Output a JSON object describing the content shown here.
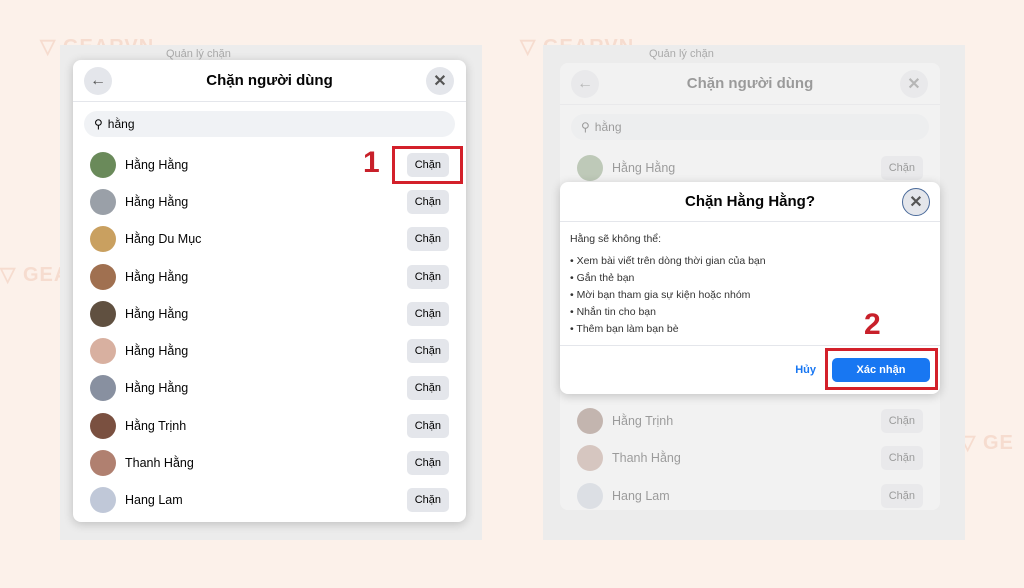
{
  "watermark": "GEARVN",
  "left": {
    "bg_heading": "Quản lý chặn",
    "title": "Chặn người dùng",
    "search_value": "hằng",
    "step": "1",
    "block_label": "Chặn",
    "users": [
      {
        "name": "Hằng Hằng",
        "color": "#6a8a5a"
      },
      {
        "name": "Hằng Hằng",
        "color": "#9aa0a8"
      },
      {
        "name": "Hằng Du Mục",
        "color": "#c9a060"
      },
      {
        "name": "Hằng Hằng",
        "color": "#a07050"
      },
      {
        "name": "Hằng Hằng",
        "color": "#605040"
      },
      {
        "name": "Hằng Hằng",
        "color": "#d8b0a0"
      },
      {
        "name": "Hằng Hằng",
        "color": "#8890a0"
      },
      {
        "name": "Hằng Trịnh",
        "color": "#7a5040"
      },
      {
        "name": "Thanh Hằng",
        "color": "#b08070"
      },
      {
        "name": "Hang Lam",
        "color": "#c0c8d8"
      }
    ]
  },
  "right": {
    "bg_heading": "Quản lý chặn",
    "title": "Chặn người dùng",
    "search_value": "hằng",
    "block_label": "Chặn",
    "bg_users": [
      "Hằng Hằng",
      "Hằng Trịnh",
      "Thanh Hằng",
      "Hang Lam"
    ],
    "dialog": {
      "title": "Chặn Hằng Hằng?",
      "intro": "Hằng sẽ không thể:",
      "items": [
        "Xem bài viết trên dòng thời gian của bạn",
        "Gắn thẻ bạn",
        "Mời bạn tham gia sự kiện hoặc nhóm",
        "Nhắn tin cho bạn",
        "Thêm bạn làm bạn bè"
      ],
      "cancel": "Hủy",
      "confirm": "Xác nhận",
      "step": "2"
    }
  },
  "colors": {
    "accent": "#1877f2",
    "highlight": "#d3202a"
  }
}
